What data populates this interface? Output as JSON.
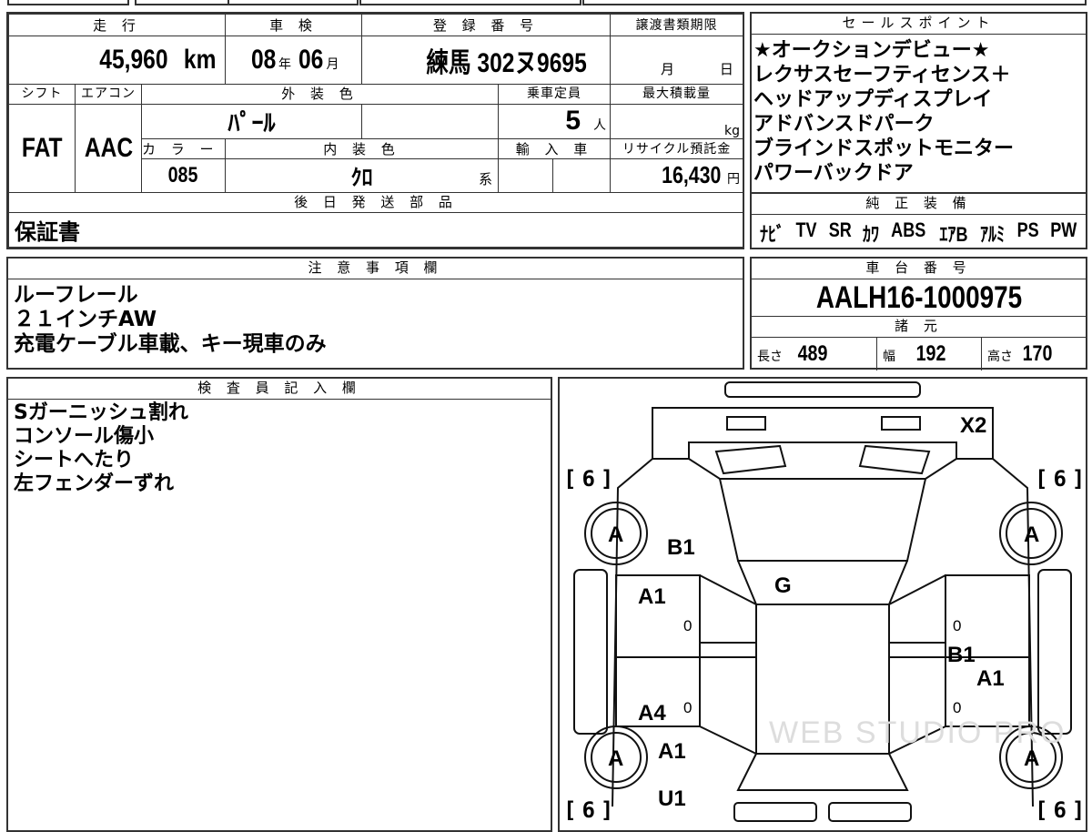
{
  "main": {
    "mileage": {
      "header": "走 行",
      "value": "45,960",
      "unit": "km"
    },
    "inspection": {
      "header": "車 検",
      "year": "08",
      "year_unit": "年",
      "month": "06",
      "month_unit": "月"
    },
    "registration": {
      "header": "登 録 番 号",
      "value": "練馬 302ヌ9695"
    },
    "transfer": {
      "header": "譲渡書類期限",
      "month_unit": "月",
      "day_unit": "日"
    },
    "shift": {
      "header": "シフト",
      "value": "FAT"
    },
    "ac": {
      "header": "エアコン",
      "value": "AAC"
    },
    "exterior": {
      "header": "外 装 色",
      "value": "ﾊﾟｰﾙ"
    },
    "capacity": {
      "header": "乗車定員",
      "value": "5",
      "unit": "人"
    },
    "max_load": {
      "header": "最大積載量",
      "unit": "kg"
    },
    "color_no": {
      "header": "カ ラ ー No.",
      "value": "085"
    },
    "interior": {
      "header": "内 装 色",
      "value": "ｸﾛ",
      "suffix": "系"
    },
    "import": {
      "header": "輸 入 車"
    },
    "recycle": {
      "header": "リサイクル預託金",
      "value": "16,430",
      "unit": "円"
    },
    "later_parts": {
      "header": "後 日 発 送 部 品",
      "value": "保証書"
    }
  },
  "sales": {
    "header": "セールスポイント",
    "lines": [
      "★オークションデビュー★",
      "レクサスセーフティセンス＋",
      "ヘッドアップディスプレイ",
      "アドバンスドパーク",
      "ブラインドスポットモニター",
      "パワーバックドア"
    ]
  },
  "equipment": {
    "header": "純 正 装 備",
    "items": [
      "ﾅﾋﾞ",
      "TV",
      "SR",
      "ｶﾜ",
      "ABS",
      "ｴｱB",
      "ｱﾙﾐ",
      "PS",
      "PW"
    ]
  },
  "notes": {
    "header": "注 意 事 項 欄",
    "lines": [
      "ルーフレール",
      "２１インチAW",
      "充電ケーブル車載、キー現車のみ"
    ]
  },
  "chassis": {
    "header": "車 台 番 号",
    "value": "AALH16-1000975",
    "spec_header": "諸 元",
    "length_label": "長さ",
    "length": "489",
    "width_label": "幅",
    "width": "192",
    "height_label": "高さ",
    "height": "170"
  },
  "inspector": {
    "header": "検 査 員 記 入 欄",
    "lines": [
      "Sガーニッシュ割れ",
      "コンソール傷小",
      "シートへたり",
      "左フェンダーずれ"
    ]
  },
  "diagram": {
    "marks": {
      "roof": "X2",
      "front_left_wheel": "A",
      "front_right_wheel": "A",
      "rear_left_wheel": "A",
      "rear_right_wheel": "A",
      "hood_left": "B1",
      "windshield": "G",
      "left_front_door": "A1",
      "left_rear_door": "A4",
      "left_rear_fender": "A1",
      "left_bumper": "U1",
      "right_door_b": "B1",
      "right_door_a": "A1"
    },
    "tires": {
      "fl": "6",
      "fr": "6",
      "rl": "6",
      "rr": "6"
    },
    "zeros": [
      "0",
      "0",
      "0",
      "0"
    ],
    "watermark": "WEB STUDIO PRO"
  }
}
